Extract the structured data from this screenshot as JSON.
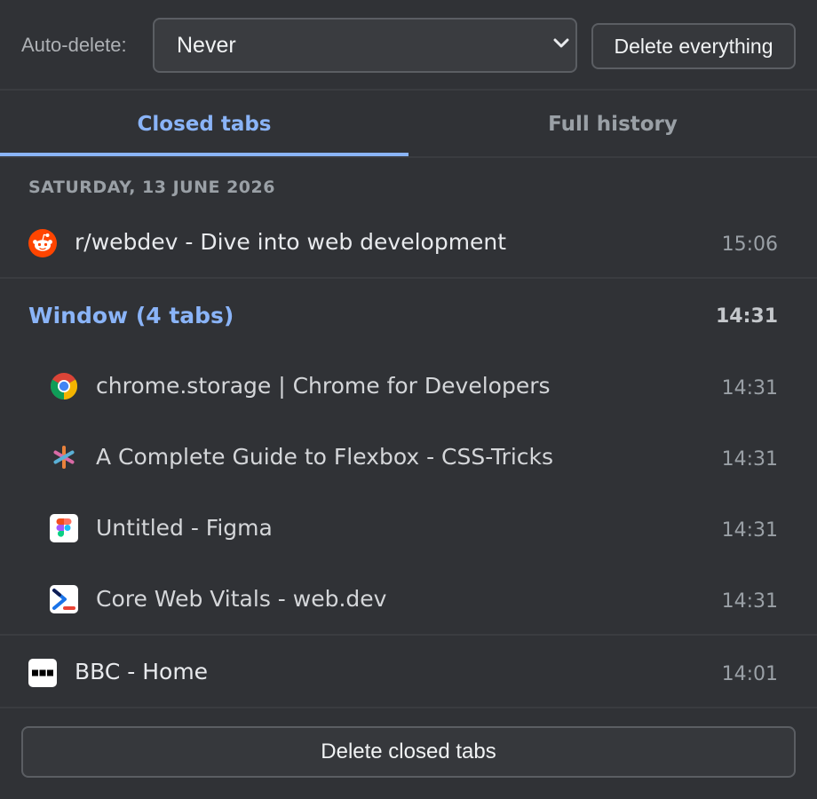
{
  "toolbar": {
    "auto_delete_label": "Auto-delete:",
    "auto_delete_value": "Never",
    "delete_everything_label": "Delete everything"
  },
  "tabs": [
    {
      "label": "Closed tabs",
      "active": true
    },
    {
      "label": "Full history",
      "active": false
    }
  ],
  "date_header": "SATURDAY, 13 JUNE 2026",
  "entries": [
    {
      "icon": "reddit-icon",
      "title": "r/webdev - Dive into web development",
      "time": "15:06"
    },
    {
      "icon": "bbc-icon",
      "title": "BBC - Home",
      "time": "14:01"
    }
  ],
  "window_group": {
    "title": "Window (4 tabs)",
    "time": "14:31",
    "items": [
      {
        "icon": "chrome-icon",
        "title": "chrome.storage | Chrome for Developers",
        "time": "14:31"
      },
      {
        "icon": "css-tricks-icon",
        "title": "A Complete Guide to Flexbox - CSS-Tricks",
        "time": "14:31"
      },
      {
        "icon": "figma-icon",
        "title": "Untitled - Figma",
        "time": "14:31"
      },
      {
        "icon": "web-dev-icon",
        "title": "Core Web Vitals - web.dev",
        "time": "14:31"
      }
    ]
  },
  "footer": {
    "delete_closed_label": "Delete closed tabs"
  },
  "colors": {
    "background": "#303236",
    "accent": "#8ab4f8",
    "muted": "#9aa0a6"
  }
}
